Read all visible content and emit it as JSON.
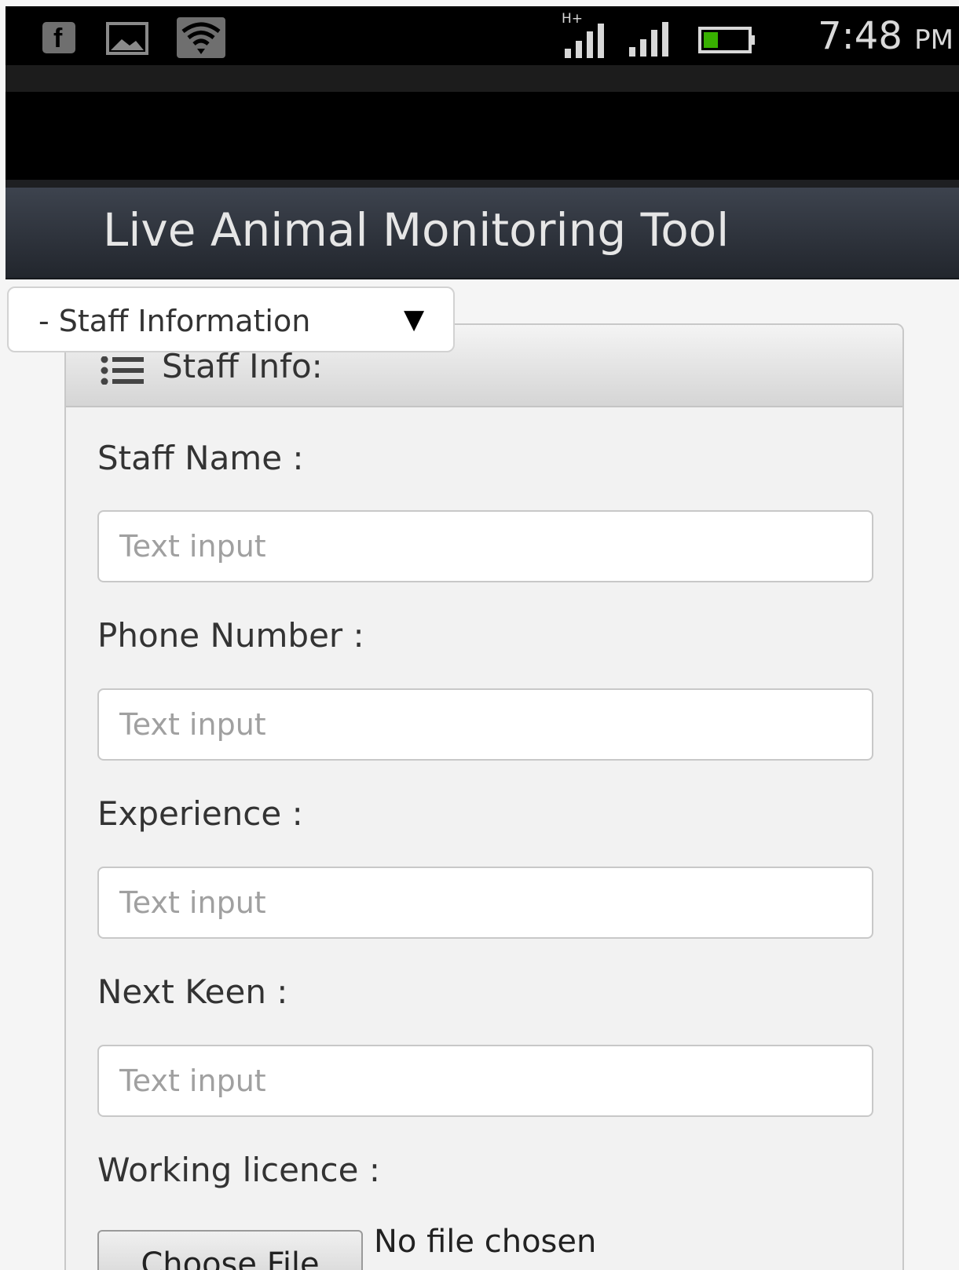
{
  "status_bar": {
    "fb_glyph": "f",
    "network_type": "H+",
    "time": "7:48",
    "ampm": "PM",
    "battery_color": "#38b000",
    "icons": [
      "facebook-icon",
      "picture-icon",
      "wifi-icon",
      "signal-icon",
      "signal-icon",
      "battery-icon"
    ]
  },
  "header": {
    "title": "Live Animal Monitoring Tool"
  },
  "section_select": {
    "value": "- Staff Information",
    "caret": "▼"
  },
  "panel": {
    "title": "Staff Info:",
    "icon": "list-icon"
  },
  "fields": {
    "staff_name": {
      "label": "Staff Name :",
      "placeholder": "Text input"
    },
    "phone_number": {
      "label": "Phone Number :",
      "placeholder": "Text input"
    },
    "experience": {
      "label": "Experience :",
      "placeholder": "Text input"
    },
    "next_keen": {
      "label": "Next Keen :",
      "placeholder": "Text input"
    },
    "working_licence": {
      "label": "Working licence :",
      "button_label": "Choose File",
      "file_status": "No file chosen"
    }
  },
  "colors": {
    "header_bg": "#2f343c",
    "panel_bg": "#f2f2f2",
    "status_bar_bg": "#000000"
  }
}
